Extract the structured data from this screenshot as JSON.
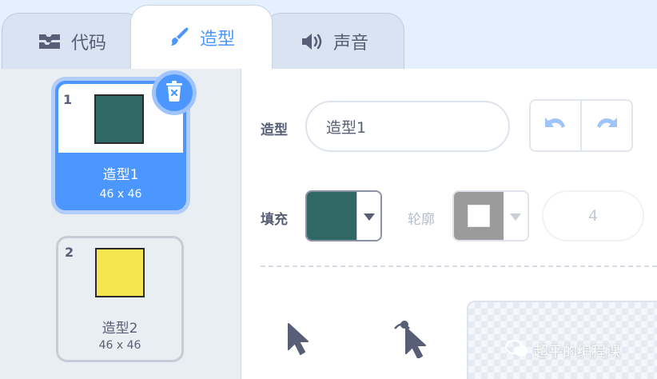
{
  "tabs": [
    {
      "label": "代码",
      "icon": "code-blocks-icon"
    },
    {
      "label": "造型",
      "icon": "paintbrush-icon",
      "active": true
    },
    {
      "label": "声音",
      "icon": "speaker-icon"
    }
  ],
  "costumes": [
    {
      "number": "1",
      "name": "造型1",
      "size": "46 x 46",
      "color": "#2f6864",
      "selected": true
    },
    {
      "number": "2",
      "name": "造型2",
      "size": "46 x 46",
      "color": "#f5e64f",
      "selected": false
    }
  ],
  "editor": {
    "costume_label": "造型",
    "costume_name": "造型1",
    "fill_label": "填充",
    "fill_color": "#2f6864",
    "outline_label": "轮廓",
    "outline_color": "#ffffff",
    "outline_width": "4"
  },
  "watermark": {
    "text": "超平的编程课"
  },
  "colors": {
    "accent": "#4c97ff",
    "text": "#575e75",
    "panel": "#e9eef2"
  }
}
